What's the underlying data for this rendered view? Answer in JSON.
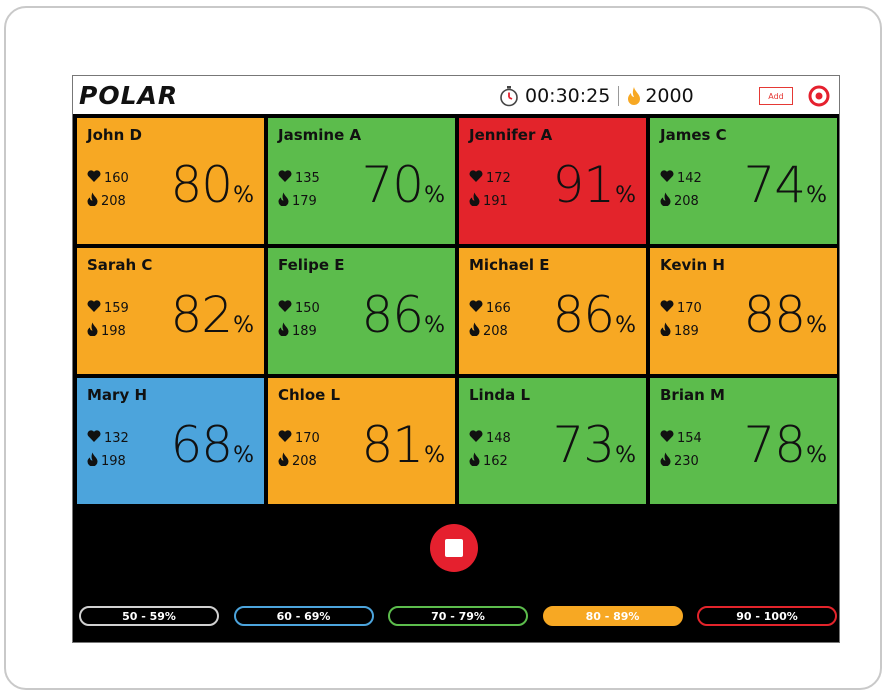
{
  "app": {
    "logo": "POLAR",
    "timer": "00:30:25",
    "calorie_target": "2000",
    "add_label": "Add"
  },
  "colors": {
    "orange": "#f7a823",
    "green": "#5cbc4c",
    "red": "#e3242b",
    "blue": "#4ca4dc",
    "gray": "#d0d0d0"
  },
  "participants": [
    {
      "name": "John D",
      "hr": "160",
      "cal": "208",
      "pct": "80",
      "zone": "orange"
    },
    {
      "name": "Jasmine A",
      "hr": "135",
      "cal": "179",
      "pct": "70",
      "zone": "green"
    },
    {
      "name": "Jennifer A",
      "hr": "172",
      "cal": "191",
      "pct": "91",
      "zone": "red"
    },
    {
      "name": "James C",
      "hr": "142",
      "cal": "208",
      "pct": "74",
      "zone": "green"
    },
    {
      "name": "Sarah C",
      "hr": "159",
      "cal": "198",
      "pct": "82",
      "zone": "orange"
    },
    {
      "name": "Felipe E",
      "hr": "150",
      "cal": "189",
      "pct": "86",
      "zone": "green"
    },
    {
      "name": "Michael E",
      "hr": "166",
      "cal": "208",
      "pct": "86",
      "zone": "orange"
    },
    {
      "name": "Kevin H",
      "hr": "170",
      "cal": "189",
      "pct": "88",
      "zone": "orange"
    },
    {
      "name": "Mary H",
      "hr": "132",
      "cal": "198",
      "pct": "68",
      "zone": "blue"
    },
    {
      "name": "Chloe L",
      "hr": "170",
      "cal": "208",
      "pct": "81",
      "zone": "orange"
    },
    {
      "name": "Linda L",
      "hr": "148",
      "cal": "162",
      "pct": "73",
      "zone": "green"
    },
    {
      "name": "Brian M",
      "hr": "154",
      "cal": "230",
      "pct": "78",
      "zone": "green"
    }
  ],
  "percent_unit": "%",
  "legend": [
    {
      "label": "50 - 59%",
      "color": "#d0d0d0",
      "filled": false
    },
    {
      "label": "60 - 69%",
      "color": "#4ca4dc",
      "filled": false
    },
    {
      "label": "70 - 79%",
      "color": "#5cbc4c",
      "filled": false
    },
    {
      "label": "80 - 89%",
      "color": "#f7a823",
      "filled": true
    },
    {
      "label": "90 - 100%",
      "color": "#e3242b",
      "filled": false
    }
  ]
}
